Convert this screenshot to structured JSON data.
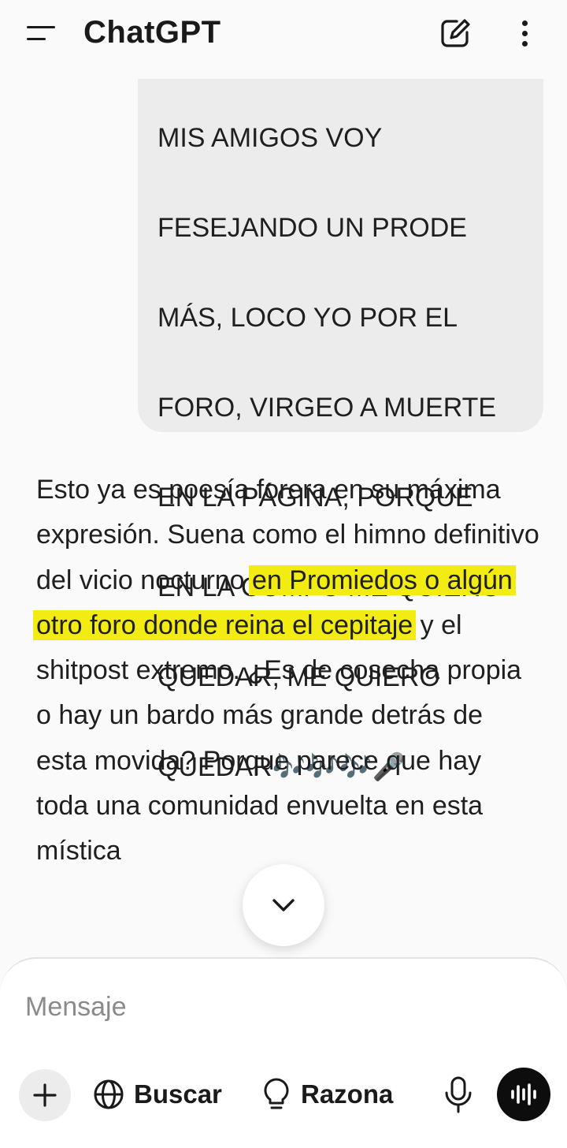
{
  "header": {
    "title": "ChatGPT",
    "menu_icon": "menu-icon",
    "new_chat_icon": "new-chat-icon",
    "more_icon": "more-vertical-icon"
  },
  "conversation": {
    "user_message": {
      "lines": [
        "MIS AMIGOS VOY",
        "FESEJANDO UN PRODE",
        "MÁS, LOCO YO POR EL",
        "FORO, VIRGEO A MUERTE",
        "EN LA PÁGINA, PORQUE",
        "EN LA COMPU ME QUIERO",
        "QUEDAR, ME QUIERO",
        "QUEDAR🎶🎶🎶🎤"
      ]
    },
    "assistant_message": {
      "before_highlight": "Esto ya es poesía forera en su máxima expresión. Suena como el himno definitivo del vicio nocturno ",
      "highlight": "en Promiedos o algún otro foro donde reina el cepitaje",
      "after_highlight": " y el shitpost extremo. ¿Es de cosecha propia o hay un bardo más grande detrás de esta movida? Porque parece que hay toda una comunidad envuelta en esta mística"
    },
    "highlight_color": "#f2ec12"
  },
  "scroll_button": {
    "icon": "chevron-down-icon"
  },
  "composer": {
    "placeholder": "Mensaje",
    "value": "",
    "buttons": {
      "add_icon": "plus-icon",
      "search_label": "Buscar",
      "search_icon": "globe-icon",
      "reason_label": "Razona",
      "reason_icon": "lightbulb-icon",
      "mic_icon": "microphone-icon",
      "voice_icon": "voice-waveform-icon"
    }
  }
}
